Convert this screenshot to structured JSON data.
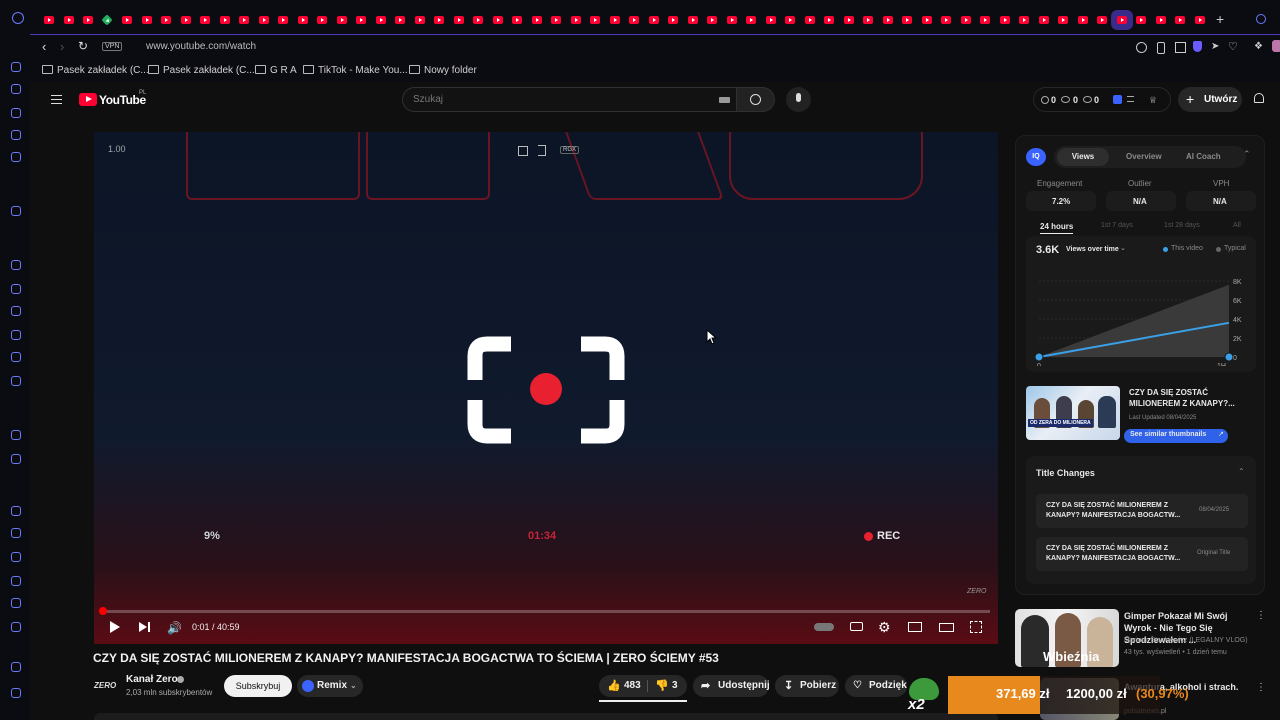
{
  "browser": {
    "address": "www.youtube.com/watch",
    "vpn_label": "VPN",
    "bookmarks": [
      "Pasek zakładek (C...",
      "Pasek zakładek (C...",
      "G R A",
      "TikTok - Make You...",
      "Nowy folder"
    ]
  },
  "yt": {
    "brand": "YouTube",
    "region": "PL",
    "search_placeholder": "Szukaj",
    "counts": [
      "0",
      "0",
      "0"
    ],
    "create_label": "Utwórz"
  },
  "video": {
    "overlay_speed": "1.00",
    "overlay_tag": "RGX",
    "left_percent": "9%",
    "timer": "01:34",
    "rec": "REC",
    "watermark": "ZERO",
    "time": "0:01 / 40:59",
    "progress": 0.002,
    "title": "CZY DA SIĘ ZOSTAĆ MILIONEREM Z KANAPY? MANIFESTACJA BOGACTWA TO ŚCIEMA | ZERO ŚCIEMY #53"
  },
  "channel": {
    "logo_text": "ZERO",
    "name": "Kanał Zero",
    "subs": "2,03 mln subskrybentów",
    "subscribe": "Subskrybuj",
    "remix": "Remix"
  },
  "actions": {
    "likes": "483",
    "dislikes": "3",
    "share": "Udostępnij",
    "download": "Pobierz",
    "thanks": "Podzięk"
  },
  "panel": {
    "badge": "IQ",
    "tabs": [
      "Views",
      "Overview",
      "AI Coach"
    ],
    "metric_labels": [
      "Engagement",
      "Outlier",
      "VPH"
    ],
    "metric_values": [
      "7.2%",
      "N/A",
      "N/A"
    ],
    "ranges": [
      "24 hours",
      "1st 7 days",
      "1st 28 days",
      "All"
    ],
    "chart_value": "3.6K",
    "chart_title": "Views over time",
    "legend": [
      "This video",
      "Typical"
    ],
    "thumb_title": "CZY DA SIĘ ZOSTAĆ MILIONEREM Z KANAPY?...",
    "thumb_updated": "Last Updated 08/04/2025",
    "similar_btn": "See similar thumbnails",
    "thumb_caption": "OD ZERA DO MILIONERA",
    "title_changes": "Title Changes",
    "changes": [
      {
        "title": "CZY DA SIĘ ZOSTAĆ MILIONEREM Z KANAPY? MANIFESTACJA BOGACTW...",
        "date": "08/04/2025"
      },
      {
        "title": "CZY DA SIĘ ZOSTAĆ MILIONEREM Z KANAPY? MANIFESTACJA BOGACTW...",
        "date": "Original Title"
      }
    ]
  },
  "chart_data": {
    "type": "line",
    "x_ticks": [
      "0",
      "1H"
    ],
    "y_ticks": [
      "8K",
      "6K",
      "4K",
      "2K",
      "0"
    ],
    "ylim": [
      0,
      8000
    ],
    "series": [
      {
        "name": "This video",
        "x": [
          0,
          1
        ],
        "values": [
          0,
          3600
        ]
      },
      {
        "name": "Typical",
        "x": [
          0,
          1
        ],
        "values": [
          0,
          7600
        ]
      }
    ]
  },
  "recommended": [
    {
      "title": "Gimper Pokazał Mi Swój Wyrok - Nie Tego Się Spodziewałem ...",
      "channel": "Mariusz Stankiewicz (LEGALNY VLOG)",
      "meta": "43 tys. wyświetleń • 1 dzień temu",
      "caption": "Wbieźnia"
    },
    {
      "title": "Awantura, alkohol i strach.",
      "channel": "polsatnews.pl",
      "meta": "",
      "caption": ""
    }
  ],
  "ticker": {
    "price": "371,69 zł",
    "target": "1200,00 zł",
    "percent": "(30,97%)",
    "mult": "x2"
  }
}
